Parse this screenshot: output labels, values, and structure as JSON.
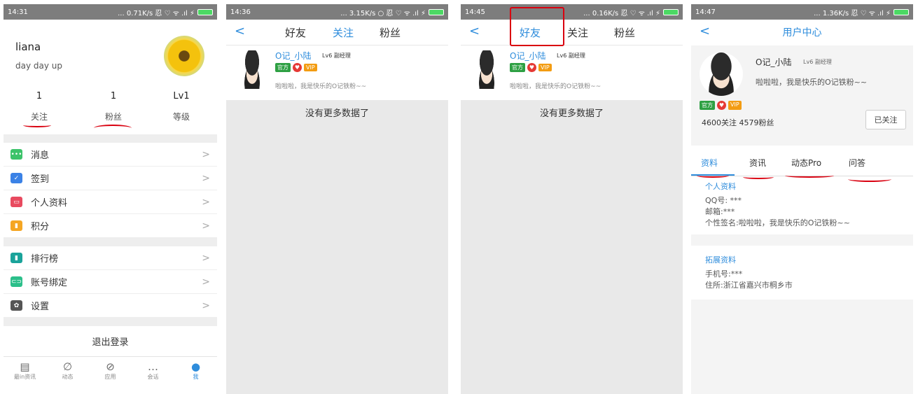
{
  "panel1": {
    "status": {
      "time": "14:31",
      "net": "... 0.71K/s 忍 ♡ ᯤ .ıl ⚡"
    },
    "profile": {
      "name": "liana",
      "signature": "day day up"
    },
    "stats": [
      {
        "value": "1",
        "label": "关注"
      },
      {
        "value": "1",
        "label": "粉丝"
      },
      {
        "value": "Lv1",
        "label": "等级"
      }
    ],
    "menu_group1": [
      {
        "label": "消息",
        "icon": "message-icon",
        "color": "#3cc36a",
        "glyph": "•••"
      },
      {
        "label": "签到",
        "icon": "checkin-icon",
        "color": "#3b82e6",
        "glyph": "✓"
      },
      {
        "label": "个人资料",
        "icon": "profile-card-icon",
        "color": "#e84a5f",
        "glyph": "▭"
      },
      {
        "label": "积分",
        "icon": "points-icon",
        "color": "#f5a623",
        "glyph": "▮"
      }
    ],
    "menu_group2": [
      {
        "label": "排行榜",
        "icon": "ranking-icon",
        "color": "#1aa39a",
        "glyph": "▮"
      },
      {
        "label": "账号绑定",
        "icon": "account-bind-icon",
        "color": "#2bbf8a",
        "glyph": "⊂⊃"
      },
      {
        "label": "设置",
        "icon": "settings-gear-icon",
        "color": "#555555",
        "glyph": "✿"
      }
    ],
    "chevron": ">",
    "logout": "退出登录",
    "tabbar": [
      {
        "label": "最in资讯",
        "glyph": "▤"
      },
      {
        "label": "动态",
        "glyph": "∅"
      },
      {
        "label": "应用",
        "glyph": "⊘"
      },
      {
        "label": "会话",
        "glyph": "…"
      },
      {
        "label": "我",
        "glyph": "●"
      }
    ]
  },
  "panel2": {
    "status": {
      "time": "14:36",
      "net": "... 3.15K/s ○ 忍 ♡ ᯤ .ıl ⚡"
    },
    "tabs": [
      "好友",
      "关注",
      "粉丝"
    ],
    "active_tab": "关注",
    "user": {
      "name": "O记_小陆",
      "level": "Lv6 副经理",
      "badge_official": "官方",
      "badge_heart": "♥",
      "badge_vip": "VIP",
      "signature": "啦啦啦，我是快乐的O记铁粉~~"
    },
    "empty": "没有更多数据了"
  },
  "panel3": {
    "status": {
      "time": "14:45",
      "net": "... 0.16K/s 忍 ♡ ᯤ .ıl ⚡"
    },
    "tabs": [
      "好友",
      "关注",
      "粉丝"
    ],
    "active_tab": "好友",
    "user": {
      "name": "O记_小陆",
      "level": "Lv6 副经理",
      "badge_official": "官方",
      "badge_heart": "♥",
      "badge_vip": "VIP",
      "signature": "啦啦啦，我是快乐的O记铁粉~~"
    },
    "empty": "没有更多数据了"
  },
  "panel4": {
    "status": {
      "time": "14:47",
      "net": "... 1.36K/s 忍 ♡ ᯤ .ıl ⚡"
    },
    "title": "用户中心",
    "user": {
      "name": "O记_小陆",
      "level": "Lv6 副经理",
      "signature": "啦啦啦，我是快乐的O记铁粉~~",
      "badge_official": "官方",
      "badge_heart": "♥",
      "badge_vip": "VIP"
    },
    "counts": "4600关注  4579粉丝",
    "follow_button": "已关注",
    "tabs": [
      "资料",
      "资讯",
      "动态Pro",
      "问答"
    ],
    "section1": {
      "title": "个人资料",
      "lines": [
        "QQ号: ***",
        "邮箱:***",
        "个性签名:啦啦啦，我是快乐的O记铁粉~~"
      ]
    },
    "section2": {
      "title": "拓展资料",
      "lines": [
        "手机号:***",
        "住所:浙江省嘉兴市桐乡市"
      ]
    }
  },
  "colors": {
    "accent": "#2f8ddc",
    "annotation_red": "#d9000f",
    "status_bar": "#7d7d7d"
  }
}
